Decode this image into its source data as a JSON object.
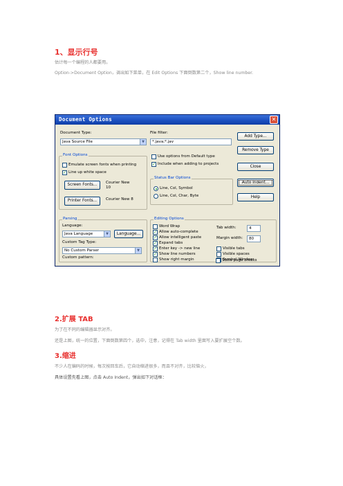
{
  "section1": {
    "heading": "1、显示行号",
    "line1": "估计每一个编程的人都要用。",
    "line2": "Option->Document Option，调出如下菜单，在 Edit Options 下面倒数第二个，Show line number."
  },
  "dialog": {
    "title": "Document Options",
    "close_glyph": "✕",
    "document_type_label": "Document Type:",
    "document_type_value": "Java Source File",
    "file_filter_label": "File filter:",
    "file_filter_value": "*.java;*.jav",
    "buttons": {
      "add_type": "Add Type...",
      "remove_type": "Remove Type",
      "close": "Close",
      "auto_indent": "Auto Indent...",
      "help": "Help",
      "screen_fonts": "Screen Fonts...",
      "printer_fonts": "Printer Fonts...",
      "language": "Language..."
    },
    "font_options": {
      "title": "Font Options",
      "emulate": "Emulate screen fonts when printing",
      "emulate_checked": false,
      "line_up": "Line up white space",
      "line_up_checked": true,
      "screen_font_name": "Courier New",
      "screen_font_size": "10",
      "printer_font": "Courier New 8"
    },
    "use_options_default": "Use options from Default type",
    "use_options_default_checked": false,
    "include_projects": "Include when adding to projects",
    "include_projects_checked": true,
    "status_bar": {
      "title": "Status Bar Options",
      "opt1": "Line, Col, Symbol",
      "opt1_selected": true,
      "opt2": "Line, Col, Char, Byte",
      "opt2_selected": false
    },
    "parsing": {
      "title": "Parsing",
      "language_label": "Language:",
      "language_value": "Java Language",
      "tag_type_label": "Custom Tag Type:",
      "tag_type_value": "No Custom Parser",
      "pattern_label": "Custom pattern:",
      "pattern_value": ""
    },
    "editing": {
      "title": "Editing Options",
      "tab_width_label": "Tab width:",
      "tab_width_value": "4",
      "margin_width_label": "Margin width:",
      "margin_width_value": "80",
      "word_wrap": "Word Wrap",
      "word_wrap_checked": false,
      "allow_auto_complete": "Allow auto-complete",
      "allow_auto_complete_checked": true,
      "allow_paste": "Allow intelligent paste",
      "allow_paste_checked": true,
      "expand_tabs": "Expand tabs",
      "expand_tabs_checked": true,
      "enter_key": "Enter key -> new line",
      "enter_key_checked": true,
      "show_line_numbers": "Show line numbers",
      "show_line_numbers_checked": true,
      "show_right_margin": "Show right margin",
      "show_right_margin_checked": false,
      "visible_tabs": "Visible tabs",
      "visible_tabs_checked": false,
      "visible_spaces": "Visible spaces",
      "visible_spaces_checked": false,
      "symbol_window": "Symbol Window",
      "symbol_window_checked": true,
      "show_page_breaks": "Show page breaks",
      "show_page_breaks_checked": false
    },
    "check_glyph": "✓",
    "arrow_glyph": "▼"
  },
  "section2": {
    "heading": "2.扩展 TAB",
    "line1": "为了在不同的编辑器显示对齐。",
    "line2": "还是上图，统一的位置，下面倒数第四个，选中，注意，记得在 Tab width 里面写入要扩展空个数。"
  },
  "section3": {
    "heading": "3.缩进",
    "line1": "不少人在编码的时候，每次按回车后，它自动缩进很多，而且不对齐，比较恼火，",
    "line2": "具体设置先看上图，点击 Auto Indent，弹出如下对话框："
  },
  "colors": {
    "heading": "#e8312f",
    "title_bar": "#1b4fbf",
    "dialog_bg": "#ece9d8",
    "group_title": "#0046d5",
    "check": "#21a121"
  }
}
